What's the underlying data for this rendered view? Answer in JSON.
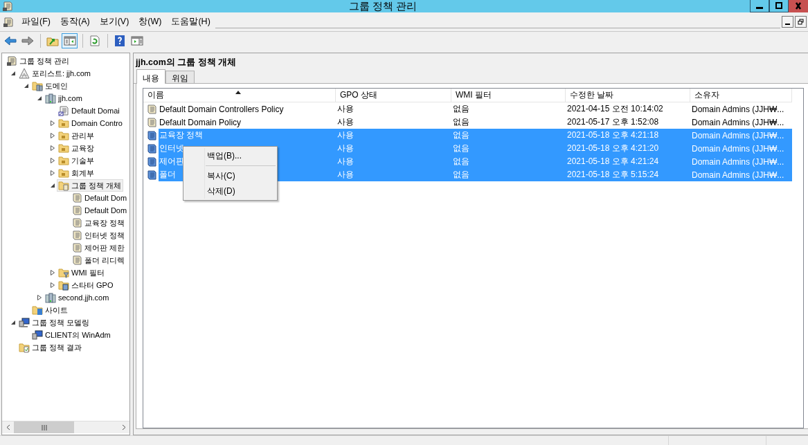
{
  "window": {
    "title": "그룹 정책 관리"
  },
  "menu_bar": {
    "items": [
      {
        "label": "파일(F)"
      },
      {
        "label": "동작(A)"
      },
      {
        "label": "보기(V)"
      },
      {
        "label": "창(W)"
      },
      {
        "label": "도움말(H)"
      }
    ]
  },
  "toolbar": {
    "buttons": [
      {
        "kind": "back",
        "pressed": false
      },
      {
        "kind": "forward",
        "pressed": false
      },
      {
        "kind": "separator"
      },
      {
        "kind": "up",
        "pressed": false
      },
      {
        "kind": "tree",
        "pressed": true
      },
      {
        "kind": "separator"
      },
      {
        "kind": "refresh",
        "pressed": false
      },
      {
        "kind": "separator"
      },
      {
        "kind": "help",
        "pressed": false
      },
      {
        "kind": "actions",
        "pressed": false
      }
    ]
  },
  "tree": {
    "items": [
      {
        "label": "그룹 정책 관리",
        "kind": "console",
        "selected": false,
        "children": [
          {
            "label": "포리스트: jjh.com",
            "kind": "forest",
            "expanded": true,
            "selected": false,
            "children": [
              {
                "label": "도메인",
                "kind": "domains",
                "expanded": true,
                "selected": false,
                "children": [
                  {
                    "label": "jjh.com",
                    "kind": "domain",
                    "expanded": true,
                    "selected": false,
                    "children": [
                      {
                        "label": "Default Domai",
                        "kind": "link",
                        "selected": false
                      },
                      {
                        "label": "Domain Contro",
                        "kind": "ou",
                        "expanded": false,
                        "selected": false
                      },
                      {
                        "label": "관리부",
                        "kind": "ou",
                        "expanded": false,
                        "selected": false
                      },
                      {
                        "label": "교육장",
                        "kind": "ou",
                        "expanded": false,
                        "selected": false
                      },
                      {
                        "label": "기술부",
                        "kind": "ou",
                        "expanded": false,
                        "selected": false
                      },
                      {
                        "label": "회계부",
                        "kind": "ou",
                        "expanded": false,
                        "selected": false
                      },
                      {
                        "label": "그룹 정책 개체",
                        "kind": "gpofolder",
                        "expanded": true,
                        "selected": true,
                        "children": [
                          {
                            "label": "Default Dom",
                            "kind": "gpo",
                            "selected": false
                          },
                          {
                            "label": "Default Dom",
                            "kind": "gpo",
                            "selected": false
                          },
                          {
                            "label": "교육장 정책",
                            "kind": "gpo",
                            "selected": false
                          },
                          {
                            "label": "인터넷 정책",
                            "kind": "gpo",
                            "selected": false
                          },
                          {
                            "label": "제어판 제한",
                            "kind": "gpo",
                            "selected": false
                          },
                          {
                            "label": "폴더 리디렉",
                            "kind": "gpo",
                            "selected": false
                          }
                        ]
                      },
                      {
                        "label": "WMI 필터",
                        "kind": "wmi",
                        "expanded": false,
                        "selected": false
                      },
                      {
                        "label": "스타터 GPO",
                        "kind": "starter",
                        "expanded": false,
                        "selected": false
                      }
                    ]
                  },
                  {
                    "label": "second.jjh.com",
                    "kind": "domain",
                    "expanded": false,
                    "selected": false
                  }
                ]
              },
              {
                "label": "사이트",
                "kind": "sites",
                "selected": false
              }
            ]
          },
          {
            "label": "그룹 정책 모델링",
            "kind": "modeling",
            "expanded": true,
            "selected": false,
            "children": [
              {
                "label": "CLIENT의 WinAdm",
                "kind": "modelitem",
                "selected": false
              }
            ]
          },
          {
            "label": "그룹 정책 결과",
            "kind": "results",
            "selected": false
          }
        ]
      }
    ]
  },
  "panel": {
    "title": "jjh.com의 그룹 정책 개체",
    "tabs": [
      {
        "label": "내용",
        "selected": true
      },
      {
        "label": "위임",
        "selected": false
      }
    ],
    "table": {
      "columns": [
        {
          "label": "이름",
          "sorted": true
        },
        {
          "label": "GPO 상태",
          "sorted": false
        },
        {
          "label": "WMI 필터",
          "sorted": false
        },
        {
          "label": "수정한 날짜",
          "sorted": false
        },
        {
          "label": "소유자",
          "sorted": false
        }
      ],
      "rows": [
        {
          "cells": [
            "Default Domain Controllers Policy",
            "사용",
            "없음",
            "2021-04-15 오전 10:14:02",
            "Domain Admins (JJH₩..."
          ],
          "selected": false
        },
        {
          "cells": [
            "Default Domain Policy",
            "사용",
            "없음",
            "2021-05-17 오후 1:52:08",
            "Domain Admins (JJH₩..."
          ],
          "selected": false
        },
        {
          "cells": [
            "교육장 정책",
            "사용",
            "없음",
            "2021-05-18 오후 4:21:18",
            "Domain Admins (JJH₩..."
          ],
          "selected": true
        },
        {
          "cells": [
            "인터넷",
            "사용",
            "없음",
            "2021-05-18 오후 4:21:20",
            "Domain Admins (JJH₩..."
          ],
          "selected": true
        },
        {
          "cells": [
            "제어판",
            "사용",
            "없음",
            "2021-05-18 오후 4:21:24",
            "Domain Admins (JJH₩..."
          ],
          "selected": true
        },
        {
          "cells": [
            "폴더",
            "사용",
            "없음",
            "2021-05-18 오후 5:15:24",
            "Domain Admins (JJH₩..."
          ],
          "selected": true
        }
      ]
    }
  },
  "context_menu": {
    "items": [
      {
        "kind": "item",
        "label": "백업(B)..."
      },
      {
        "kind": "separator"
      },
      {
        "kind": "item",
        "label": "복사(C)"
      },
      {
        "kind": "item",
        "label": "삭제(D)"
      }
    ]
  }
}
